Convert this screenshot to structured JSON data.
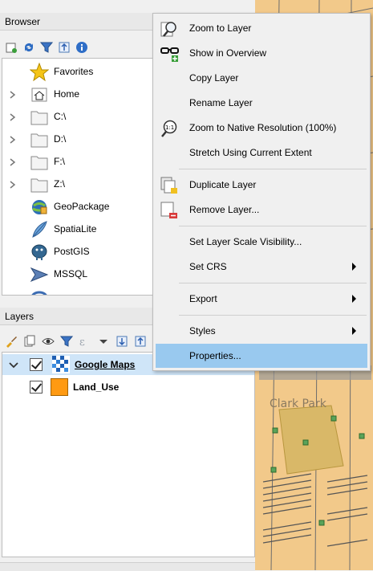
{
  "browser": {
    "title": "Browser",
    "items": [
      {
        "label": "Favorites",
        "icon": "star-icon"
      },
      {
        "label": "Home",
        "icon": "home-icon"
      },
      {
        "label": "C:\\",
        "icon": "folder-icon"
      },
      {
        "label": "D:\\",
        "icon": "folder-icon"
      },
      {
        "label": "F:\\",
        "icon": "folder-icon"
      },
      {
        "label": "Z:\\",
        "icon": "folder-icon"
      },
      {
        "label": "GeoPackage",
        "icon": "geopackage-icon"
      },
      {
        "label": "SpatiaLite",
        "icon": "spatialite-icon"
      },
      {
        "label": "PostGIS",
        "icon": "postgis-icon"
      },
      {
        "label": "MSSQL",
        "icon": "mssql-icon"
      }
    ]
  },
  "layers": {
    "title": "Layers",
    "items": [
      {
        "label": "Google Maps",
        "checked": true,
        "swatch": "#1f5fb3"
      },
      {
        "label": "Land_Use",
        "checked": true,
        "swatch": "#ff9a12"
      }
    ]
  },
  "context_menu": {
    "items": [
      {
        "label": "Zoom to Layer"
      },
      {
        "label": "Show in Overview"
      },
      {
        "label": "Copy Layer"
      },
      {
        "label": "Rename Layer"
      },
      {
        "label": "Zoom to Native Resolution (100%)"
      },
      {
        "label": "Stretch Using Current Extent"
      },
      {
        "label": "Duplicate Layer"
      },
      {
        "label": "Remove Layer..."
      },
      {
        "label": "Set Layer Scale Visibility..."
      },
      {
        "label": "Set CRS"
      },
      {
        "label": "Export"
      },
      {
        "label": "Styles"
      },
      {
        "label": "Properties..."
      }
    ],
    "selected": "Properties..."
  },
  "map": {
    "label": "Clark Park",
    "fill_color": "#f2c98a",
    "park_color": "#d9b868"
  }
}
